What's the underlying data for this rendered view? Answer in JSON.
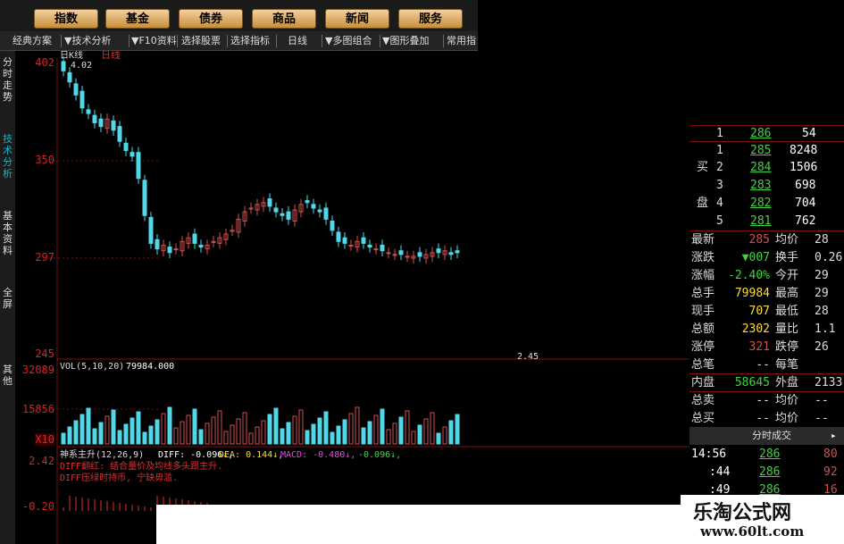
{
  "nav": {
    "buttons": [
      "指数",
      "基金",
      "债券",
      "商品",
      "新闻",
      "服务"
    ]
  },
  "toolbar": {
    "items": [
      "经典方案",
      "▼技术分析",
      "▼F10资料",
      "选择股票",
      "选择指标",
      "日线",
      "▼多图组合",
      "▼图形叠加",
      "常用指"
    ]
  },
  "sidetabs": [
    "分时走势",
    "技术分析",
    "基本资料",
    "全屏",
    "其他"
  ],
  "price_axis": {
    "labels": [
      "402",
      "350",
      "297",
      "245"
    ]
  },
  "kline": {
    "title": "日K线",
    "period": "日线",
    "high_label": "4.02",
    "low_label": "2.45"
  },
  "volume": {
    "header": "VOL(5,10,20)",
    "value": "79984.000",
    "arrow": "↓",
    "axis": [
      "32089",
      "15856",
      "X10"
    ]
  },
  "macd": {
    "header_name": "神系主升(12,26,9)",
    "diff_label": "DIFF: -0.096↓,",
    "dea_label": "DEA: 0.144↓,",
    "macd_label": "MACD: -0.480↓,",
    "extra_label": "-0.096↓,",
    "note1": "DIFF翻红: 结合量价及均线多头跟主升.",
    "note2": "DIFF压绿时持币, 宁缺毋滥.",
    "axis": [
      "2.42",
      "-0.20"
    ]
  },
  "quote": {
    "order_book": [
      {
        "idx": "1",
        "price": "286",
        "vol": "54"
      },
      {
        "idx": "1",
        "price": "285",
        "vol": "8248"
      },
      {
        "idx": "2",
        "price": "284",
        "vol": "1506"
      },
      {
        "idx": "3",
        "price": "283",
        "vol": "698"
      },
      {
        "idx": "4",
        "price": "282",
        "vol": "704"
      },
      {
        "idx": "5",
        "price": "281",
        "vol": "762"
      }
    ],
    "buy_label_1": "买",
    "buy_label_2": "盘",
    "stats": [
      {
        "l1": "最新",
        "v1": "285",
        "l2": "均价",
        "v2": "28"
      },
      {
        "l1": "涨跌",
        "v1": "▼007",
        "l2": "换手",
        "v2": "0.26"
      },
      {
        "l1": "涨幅",
        "v1": "-2.40%",
        "l2": "今开",
        "v2": "29"
      },
      {
        "l1": "总手",
        "v1": "79984",
        "l2": "最高",
        "v2": "29"
      },
      {
        "l1": "现手",
        "v1": "707",
        "l2": "最低",
        "v2": "28"
      },
      {
        "l1": "总额",
        "v1": "2302",
        "l2": "量比",
        "v2": "1.1"
      },
      {
        "l1": "涨停",
        "v1": "321",
        "l2": "跌停",
        "v2": "26"
      },
      {
        "l1": "总笔",
        "v1": "--",
        "l2": "每笔",
        "v2": ""
      },
      {
        "l1": "内盘",
        "v1": "58645",
        "l2": "外盘",
        "v2": "2133"
      },
      {
        "l1": "总卖",
        "v1": "--",
        "l2": "均价",
        "v2": "--"
      },
      {
        "l1": "总买",
        "v1": "--",
        "l2": "均价",
        "v2": "--"
      }
    ],
    "ticks_header": "分时成交",
    "ticks": [
      {
        "time": "14:56",
        "price": "286",
        "vol": "80"
      },
      {
        "time": ":44",
        "price": "286",
        "vol": "92"
      },
      {
        "time": ":49",
        "price": "286",
        "vol": "16"
      }
    ]
  },
  "watermark": {
    "line1": "乐淘公式网",
    "line2": "www.60lt.com"
  },
  "colors": {
    "up": "#d05050",
    "down": "#50d8e8",
    "axis": "#e02020",
    "grid": "#7a1010",
    "nav_gradient_top": "#f1d0a0",
    "nav_gradient_bottom": "#c88f3c"
  },
  "chart_data": {
    "type": "candlestick",
    "price_axis_labels": [
      "402",
      "350",
      "297",
      "245"
    ],
    "close_series": [
      398,
      392,
      385,
      378,
      375,
      370,
      368,
      372,
      366,
      360,
      355,
      352,
      340,
      320,
      305,
      302,
      304,
      300,
      302,
      306,
      308,
      305,
      303,
      304,
      306,
      308,
      310,
      312,
      318,
      322,
      324,
      326,
      327,
      325,
      322,
      320,
      318,
      323,
      326,
      327,
      324,
      322,
      318,
      312,
      306,
      305,
      304,
      306,
      305,
      303,
      302,
      301,
      300,
      299,
      299,
      298,
      298,
      298,
      299,
      300,
      300,
      301,
      299,
      300
    ]
  }
}
